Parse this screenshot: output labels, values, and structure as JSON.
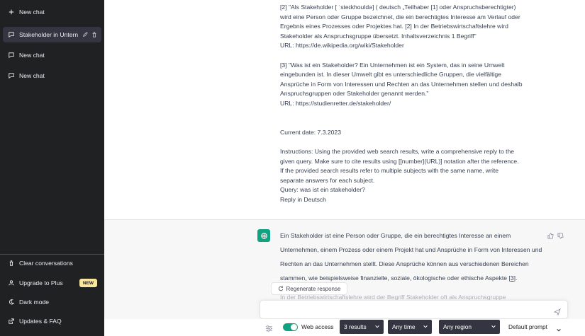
{
  "sidebar": {
    "new_chat_top": "New chat",
    "chats": [
      {
        "label": "Stakeholder in Untern",
        "active": true
      },
      {
        "label": "New chat",
        "active": false
      },
      {
        "label": "New chat",
        "active": false
      }
    ],
    "bottom": [
      {
        "label": "Clear conversations",
        "icon": "trash-icon"
      },
      {
        "label": "Upgrade to Plus",
        "icon": "user-icon",
        "badge": "NEW"
      },
      {
        "label": "Dark mode",
        "icon": "moon-icon"
      },
      {
        "label": "Updates & FAQ",
        "icon": "external-link-icon"
      }
    ]
  },
  "user_message": "[2] \"Als Stakeholder [ ˈsteɪkhoʊldə] ( deutsch „Teilhaber [1] oder Anspruchsberechtigter)\nwird eine Person oder Gruppe bezeichnet, die ein berechtigtes Interesse am Verlauf oder\nErgebnis eines Prozesses oder Projektes hat. [2] In der Betriebswirtschaftslehre wird\nStakeholder als Anspruchsgruppe übersetzt. Inhaltsverzeichnis 1 Begriff\"\nURL: https://de.wikipedia.org/wiki/Stakeholder\n\n[3] \"Was ist ein Stakeholder? Ein Unternehmen ist ein System, das in seine Umwelt\neingebunden ist. In dieser Umwelt gibt es unterschiedliche Gruppen, die vielfältige\nAnsprüche in Form von Interessen und Rechten an das Unternehmen stellen und deshalb\nAnspruchsgruppen oder Stakeholder genannt werden.\"\nURL: https://studienretter.de/stakeholder/\n\n\nCurrent date: 7.3.2023\n\nInstructions: Using the provided web search results, write a comprehensive reply to the\ngiven query. Make sure to cite results using [[number](URL)] notation after the reference.\nIf the provided search results refer to multiple subjects with the same name, write\nseparate answers for each subject.\nQuery: was ist ein stakeholder?\nReply in Deutsch",
  "assistant_message": {
    "text": "Ein Stakeholder ist eine Person oder Gruppe, die ein berechtigtes Interesse an einem Unternehmen, einem Prozess oder einem Projekt hat und Ansprüche in Form von Interessen und Rechten an das Unternehmen stellt. Diese Ansprüche können aus verschiedenen Bereichen stammen, wie beispielsweise finanzielle, soziale, ökologische oder ethische Aspekte [",
    "cite": "3",
    "text_end": "].",
    "faded": "In der Betriebswirtschaftslehre wird der Begriff Stakeholder oft als Anspruchsgruppe"
  },
  "regenerate_label": "Regenerate response",
  "toolbar": {
    "web_access": "Web access",
    "results": "3 results",
    "time": "Any time",
    "region": "Any region",
    "prompt": "Default prompt"
  },
  "colors": {
    "accent": "#10a37f",
    "sidebar": "#202123"
  }
}
